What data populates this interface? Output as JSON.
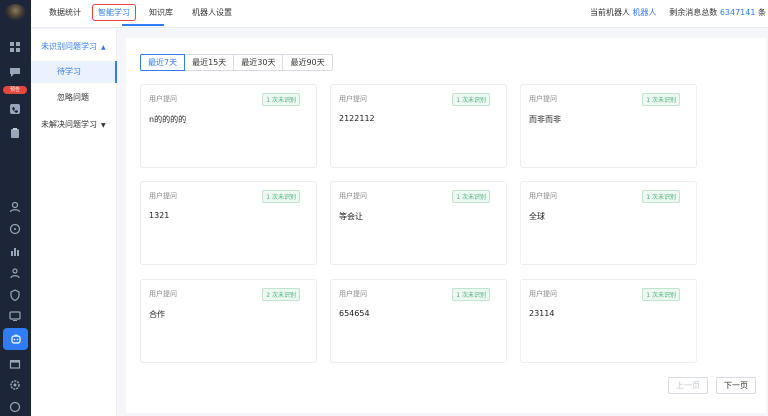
{
  "topbar": {
    "tabs": [
      "数据统计",
      "智能学习",
      "知识库",
      "机器人设置"
    ],
    "current_robot_label": "当前机器人",
    "current_robot_value": "机器人",
    "remaining_label": "剩余消息总数",
    "remaining_value": "6347141",
    "remaining_unit": "条"
  },
  "rail": {
    "badge": "预告",
    "accent_color": "#2f7cf6"
  },
  "subnav": {
    "group1": "未识别问题学习",
    "group1_items": [
      "待学习",
      "忽略问题"
    ],
    "group2": "未解决问题学习"
  },
  "filters": [
    "最近7天",
    "最近15天",
    "最近30天",
    "最近90天"
  ],
  "cards": [
    {
      "label": "用户提问",
      "tag": "1 次未识别",
      "question": "n的的的的"
    },
    {
      "label": "用户提问",
      "tag": "1 次未识别",
      "question": "2122112"
    },
    {
      "label": "用户提问",
      "tag": "1 次未识别",
      "question": "而非而非"
    },
    {
      "label": "用户提问",
      "tag": "1 次未识别",
      "question": "1321"
    },
    {
      "label": "用户提问",
      "tag": "1 次未识别",
      "question": "等会让"
    },
    {
      "label": "用户提问",
      "tag": "1 次未识别",
      "question": "全球"
    },
    {
      "label": "用户提问",
      "tag": "2 次未识别",
      "question": "合作"
    },
    {
      "label": "用户提问",
      "tag": "1 次未识别",
      "question": "654654"
    },
    {
      "label": "用户提问",
      "tag": "1 次未识别",
      "question": "23114"
    }
  ],
  "pager": {
    "prev": "上一页",
    "next": "下一页"
  }
}
